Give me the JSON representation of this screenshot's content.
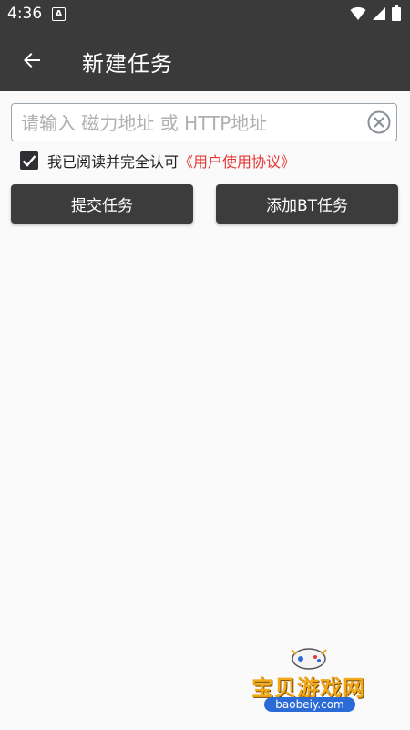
{
  "status_bar": {
    "time": "4:36",
    "notification_letter": "A"
  },
  "app_bar": {
    "title": "新建任务"
  },
  "url_input": {
    "placeholder": "请输入 磁力地址 或 HTTP地址",
    "value": ""
  },
  "agreement": {
    "checked": true,
    "text": "我已阅读并完全认可",
    "link": "《用户使用协议》"
  },
  "buttons": {
    "submit": "提交任务",
    "add_bt": "添加BT任务"
  },
  "watermark": {
    "text": "宝贝游戏网",
    "domain": "baobeiy.com"
  },
  "colors": {
    "toolbar": "#3a3a3a",
    "link": "#e53935",
    "button": "#3c3c3c",
    "background": "#fafafa"
  }
}
